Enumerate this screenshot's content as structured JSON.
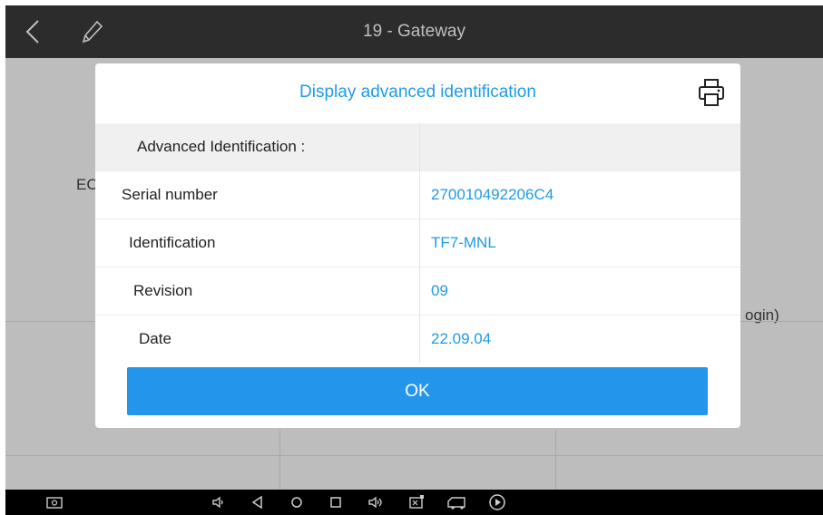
{
  "header": {
    "title": "19 - Gateway"
  },
  "background": {
    "ecu_label": "EC",
    "login_fragment": "ogin)"
  },
  "dialog": {
    "title": "Display advanced identification",
    "section_header": "Advanced Identification :",
    "rows": [
      {
        "label": "Serial number",
        "value": "270010492206C4"
      },
      {
        "label": "Identification",
        "value": "TF7-MNL"
      },
      {
        "label": "Revision",
        "value": "09"
      },
      {
        "label": "Date",
        "value": "22.09.04"
      }
    ],
    "ok_label": "OK"
  },
  "colors": {
    "accent": "#1e9be6",
    "button": "#2396ec",
    "topbar": "#2c2c2c"
  },
  "icons": {
    "topbar": [
      "back-chevron-icon",
      "edit-pencil-icon"
    ],
    "dialog": [
      "print-icon"
    ],
    "navbar": [
      "screenshot-icon",
      "volume-down-icon",
      "back-icon",
      "home-icon",
      "recents-icon",
      "volume-up-icon",
      "vci-icon",
      "truck-icon",
      "play-icon"
    ]
  }
}
